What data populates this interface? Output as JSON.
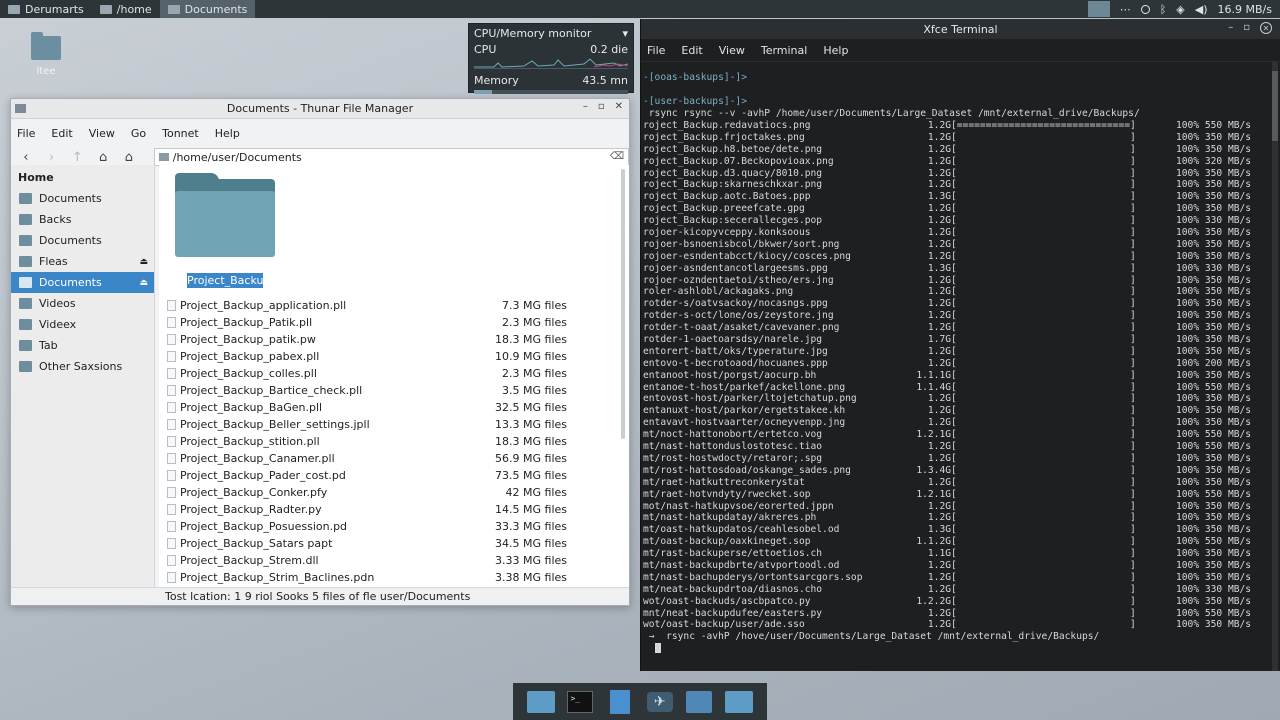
{
  "top_panel": {
    "items": [
      {
        "label": "Derumarts",
        "active": false
      },
      {
        "label": "/home",
        "active": false
      },
      {
        "label": "Documents",
        "active": true
      }
    ],
    "network_speed": "16.9 MB/s"
  },
  "desktop": {
    "icon_label": "ltee"
  },
  "cpu_monitor": {
    "title": "CPU/Memory monitor",
    "cpu_label": "CPU",
    "cpu_value": "0.2 die",
    "memory_label": "Memory",
    "memory_value": "43.5 mn",
    "memory_fill": 0.12
  },
  "thunar": {
    "title": "Documents - Thunar File Manager",
    "menu": [
      "File",
      "Edit",
      "View",
      "Go",
      "Tonnet",
      "Help"
    ],
    "path": "/home/user/Documents",
    "sidebar_heading": "Home",
    "sidebar": [
      {
        "label": "Documents",
        "selected": false,
        "eject": false
      },
      {
        "label": "Backs",
        "selected": false,
        "eject": false
      },
      {
        "label": "Documents",
        "selected": false,
        "eject": false
      },
      {
        "label": "Fleas",
        "selected": false,
        "eject": true
      },
      {
        "label": "Documents",
        "selected": true,
        "eject": true
      },
      {
        "label": "Videos",
        "selected": false,
        "eject": false
      },
      {
        "label": "Videex",
        "selected": false,
        "eject": false
      },
      {
        "label": "Tab",
        "selected": false,
        "eject": false
      },
      {
        "label": "Other Saxsions",
        "selected": false,
        "eject": false
      }
    ],
    "folder_label": "Project_Backup",
    "files": [
      {
        "name": "Project_Backup_application.pll",
        "size": "7.3 MG files"
      },
      {
        "name": "Project_Backup_Patik.pll",
        "size": "2.3 MG files"
      },
      {
        "name": "Project_Backup_patik.pw",
        "size": "18.3 MG files"
      },
      {
        "name": "Project_Backup_pabex.pll",
        "size": "10.9 MG files"
      },
      {
        "name": "Project_Backup_colles.pll",
        "size": "2.3 MG files"
      },
      {
        "name": "Project_Backup_Bartice_check.pll",
        "size": "3.5 MG files"
      },
      {
        "name": "Project_Backup_BaGen.pll",
        "size": "32.5 MG files"
      },
      {
        "name": "Project_Backup_Beller_settings.jpll",
        "size": "13.3 MG files"
      },
      {
        "name": "Project_Backup_stition.pll",
        "size": "18.3 MG files"
      },
      {
        "name": "Project_Backup_Canamer.pll",
        "size": "56.9 MG files"
      },
      {
        "name": "Project_Backup_Pader_cost.pd",
        "size": "73.5 MG files"
      },
      {
        "name": "Project_Backup_Conker.pfy",
        "size": "42 MG files"
      },
      {
        "name": "Project_Backup_Radter.py",
        "size": "14.5 MG files"
      },
      {
        "name": "Project_Backup_Posuession.pd",
        "size": "33.3 MG files"
      },
      {
        "name": "Project_Backup_Satars papt",
        "size": "34.5 MG files"
      },
      {
        "name": "Project_Backup_Strem.dll",
        "size": "3.33 MG files"
      },
      {
        "name": "Project_Backup_Strim_Baclines.pdn",
        "size": "3.38 MG files"
      }
    ],
    "status": "Tost lcation: 1 9 riol Sooks 5 files of fle user/Documents"
  },
  "terminal": {
    "title": "Xfce Terminal",
    "menu": [
      "File",
      "Edit",
      "View",
      "Terminal",
      "Help"
    ],
    "prompt1": "-[ooas-baskups]-]>",
    "prompt2": "-[user-backups]-]>",
    "command": " rsync rsync --v -avhP /home/user/Documents/Large_Dataset /mnt/external_drive/Backups/",
    "lines": [
      {
        "name": "roject_Backup.redavatiocs.png",
        "size": "1.2G",
        "bar": "[==============================]",
        "pct": "100% 550 MB/s"
      },
      {
        "name": "roject_Backup.frjoctakes.png",
        "size": "1.2G",
        "bar": "[                              ]",
        "pct": "100% 350 MB/s"
      },
      {
        "name": "roject_Backup.h8.betoe/dete.png",
        "size": "1.2G",
        "bar": "[                              ]",
        "pct": "100% 350 MB/s"
      },
      {
        "name": "roject_Backup.07.Beckopovioax.png",
        "size": "1.2G",
        "bar": "[                              ]",
        "pct": "100% 320 MB/s"
      },
      {
        "name": "roject_Backup.d3.quacy/8010.png",
        "size": "1.2G",
        "bar": "[                              ]",
        "pct": "100% 350 MB/s"
      },
      {
        "name": "roject_Backup:skarneschkxar.png",
        "size": "1.2G",
        "bar": "[                              ]",
        "pct": "100% 350 MB/s"
      },
      {
        "name": "roject_Backup.aotc.Batoes.ppp",
        "size": "1.3G",
        "bar": "[                              ]",
        "pct": "100% 350 MB/s"
      },
      {
        "name": "roject_Backup.preeefcate.gpg",
        "size": "1.2G",
        "bar": "[                              ]",
        "pct": "100% 350 MB/s"
      },
      {
        "name": "roject_Backup:secerallecges.pop",
        "size": "1.2G",
        "bar": "[                              ]",
        "pct": "100% 330 MB/s"
      },
      {
        "name": "rojoer-kicopyvceppy.konksoous",
        "size": "1.2G",
        "bar": "[                              ]",
        "pct": "100% 350 MB/s"
      },
      {
        "name": "rojoer-bsnoenisbcol/bkwer/sort.png",
        "size": "1.2G",
        "bar": "[                              ]",
        "pct": "100% 350 MB/s"
      },
      {
        "name": "rojoer-esndentabcct/kiocy/cosces.png",
        "size": "1.2G",
        "bar": "[                              ]",
        "pct": "100% 350 MB/s"
      },
      {
        "name": "rojoer-asndentancotlargeesms.ppg",
        "size": "1.3G",
        "bar": "[                              ]",
        "pct": "100% 330 MB/s"
      },
      {
        "name": "rojoer-ozndentaetoi/stheo/ers.jng",
        "size": "1.2G",
        "bar": "[                              ]",
        "pct": "100% 350 MB/s"
      },
      {
        "name": "roler-ashlobl/ackagaks.png",
        "size": "1.2G",
        "bar": "[                              ]",
        "pct": "100% 350 MB/s"
      },
      {
        "name": "rotder-s/oatvsackoy/nocasngs.ppg",
        "size": "1.2G",
        "bar": "[                              ]",
        "pct": "100% 350 MB/s"
      },
      {
        "name": "rotder-s-oct/lone/os/zeystore.jng",
        "size": "1.2G",
        "bar": "[                              ]",
        "pct": "100% 350 MB/s"
      },
      {
        "name": "rotder-t-oaat/asaket/cavevaner.png",
        "size": "1.2G",
        "bar": "[                              ]",
        "pct": "100% 350 MB/s"
      },
      {
        "name": "rotder-1-oaetoarsdsy/narele.jpg",
        "size": "1.7G",
        "bar": "[                              ]",
        "pct": "100% 350 MB/s"
      },
      {
        "name": "entorert-batt/oks/typerature.jpg",
        "size": "1.2G",
        "bar": "[                              ]",
        "pct": "100% 350 MB/s"
      },
      {
        "name": "entovo-t-becrotoaod/hocuanes.ppp",
        "size": "1.2G",
        "bar": "[                              ]",
        "pct": "100% 200 MB/s"
      },
      {
        "name": "entanoot-host/porgst/aocurp.bh",
        "size": "1.1.1G",
        "bar": "[                              ]",
        "pct": "100% 350 MB/s"
      },
      {
        "name": "entanoe-t-host/parkef/ackellone.png",
        "size": "1.1.4G",
        "bar": "[                              ]",
        "pct": "100% 550 MB/s"
      },
      {
        "name": "entovost-host/parker/ltojetchatup.png",
        "size": "1.2G",
        "bar": "[                              ]",
        "pct": "100% 350 MB/s"
      },
      {
        "name": "entanuxt-host/parkor/ergetstakee.kh",
        "size": "1.2G",
        "bar": "[                              ]",
        "pct": "100% 350 MB/s"
      },
      {
        "name": "entavavt-hostvaarter/ocneyvenpp.jng",
        "size": "1.2G",
        "bar": "[                              ]",
        "pct": "100% 350 MB/s"
      },
      {
        "name": "mt/noct-hattonobort/ertetco.vog",
        "size": "1.2.1G",
        "bar": "[                              ]",
        "pct": "100% 550 MB/s"
      },
      {
        "name": "mt/nast-hattonduslostotesc.tiao",
        "size": "1.2G",
        "bar": "[                              ]",
        "pct": "100% 550 MB/s"
      },
      {
        "name": "mt/rost-hostwdocty/retaror;.spg",
        "size": "1.2G",
        "bar": "[                              ]",
        "pct": "100% 350 MB/s"
      },
      {
        "name": "mt/rost-hattosdoad/oskange_sades.png",
        "size": "1.3.4G",
        "bar": "[                              ]",
        "pct": "100% 350 MB/s"
      },
      {
        "name": "mt/raet-hatkuttreconkerystat",
        "size": "1.2G",
        "bar": "[                              ]",
        "pct": "100% 350 MB/s"
      },
      {
        "name": "mt/raet-hotvndyty/rwecket.sop",
        "size": "1.2.1G",
        "bar": "[                              ]",
        "pct": "100% 550 MB/s"
      },
      {
        "name": "mot/nast-hatkupvsoe/eorerted.jppn",
        "size": "1.2G",
        "bar": "[                              ]",
        "pct": "100% 350 MB/s"
      },
      {
        "name": "mt/nast-hatkupdatay/akreres.ph",
        "size": "1.2G",
        "bar": "[                              ]",
        "pct": "100% 350 MB/s"
      },
      {
        "name": "mt/oast-hatkupdatos/ceahlesobel.od",
        "size": "1.3G",
        "bar": "[                              ]",
        "pct": "100% 350 MB/s"
      },
      {
        "name": "mt/oast-backup/oaxkineget.sop",
        "size": "1.1.2G",
        "bar": "[                              ]",
        "pct": "100% 550 MB/s"
      },
      {
        "name": "mt/rast-backuperse/ettoetios.ch",
        "size": "1.1G",
        "bar": "[                              ]",
        "pct": "100% 350 MB/s"
      },
      {
        "name": "mt/nast-backupdbrte/atvportoodl.od",
        "size": "1.2G",
        "bar": "[                              ]",
        "pct": "100% 350 MB/s"
      },
      {
        "name": "mt/nast-bachupderys/ortontsarcgors.sop",
        "size": "1.2G",
        "bar": "[                              ]",
        "pct": "100% 350 MB/s"
      },
      {
        "name": "mt/neat-backupdrtoa/diasnos.cho",
        "size": "1.2G",
        "bar": "[                              ]",
        "pct": "100% 330 MB/s"
      },
      {
        "name": "wot/oast-backuds/ascbpatco.py",
        "size": "1.2.2G",
        "bar": "[                              ]",
        "pct": "100% 350 MB/s"
      },
      {
        "name": "mnt/neat-backupdufee/easters.py",
        "size": "1.2G",
        "bar": "[                              ]",
        "pct": "100% 550 MB/s"
      },
      {
        "name": "wot/oast-backup/user/ade.sso",
        "size": "1.2G",
        "bar": "[                              ]",
        "pct": "100% 350 MB/s"
      }
    ],
    "final_command": " →  rsync -avhP /hove/user/Documents/Large_Dataset /mnt/external_drive/Backups/"
  }
}
